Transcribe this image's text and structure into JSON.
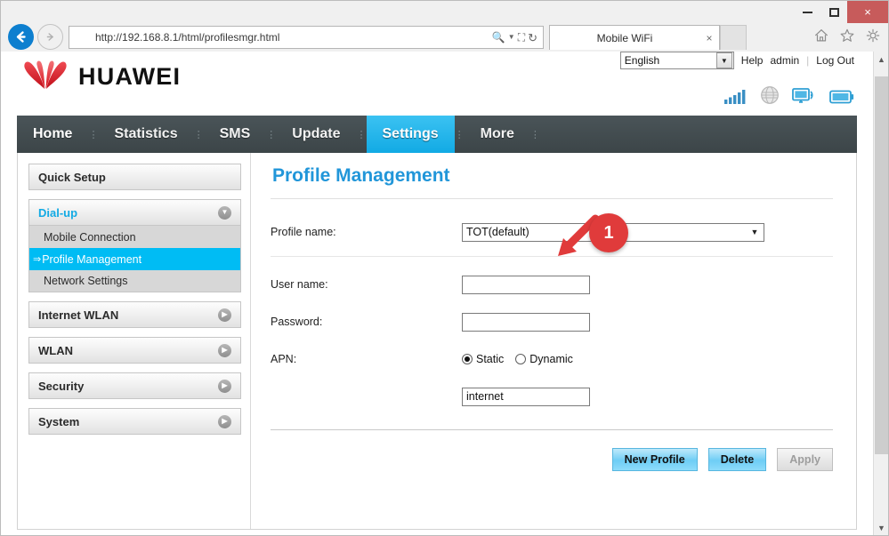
{
  "window": {
    "minimize_label": "minimize",
    "maximize_label": "maximize",
    "close_label": "×"
  },
  "browser": {
    "back_icon": "back-arrow-icon",
    "forward_icon": "forward-arrow-icon",
    "url": "http://192.168.8.1/html/profilesmgr.html",
    "search_icon": "search-icon",
    "dropdown_icon": "caret-down-icon",
    "compat_icon": "compatibility-view-icon",
    "refresh_icon": "refresh-icon",
    "tab_title": "Mobile WiFi",
    "tab_close": "×",
    "home_icon": "home-icon",
    "favorites_icon": "star-icon",
    "settings_icon": "gear-icon"
  },
  "header": {
    "brand": "HUAWEI",
    "language": "English",
    "help_label": "Help",
    "user_label": "admin",
    "separator": "|",
    "logout_label": "Log Out",
    "status_icons": [
      "signal-bars-icon",
      "globe-icon",
      "monitor-wifi-icon",
      "battery-icon"
    ]
  },
  "mainnav": {
    "items": [
      {
        "label": "Home",
        "active": false
      },
      {
        "label": "Statistics",
        "active": false
      },
      {
        "label": "SMS",
        "active": false
      },
      {
        "label": "Update",
        "active": false
      },
      {
        "label": "Settings",
        "active": true
      },
      {
        "label": "More",
        "active": false
      }
    ],
    "active_color": "#12aae4"
  },
  "sidebar": {
    "quick_setup": "Quick Setup",
    "dialup": {
      "label": "Dial-up",
      "expanded": true,
      "items": [
        {
          "label": "Mobile Connection",
          "selected": false
        },
        {
          "label": "Profile Management",
          "selected": true
        },
        {
          "label": "Network Settings",
          "selected": false
        }
      ]
    },
    "groups": [
      {
        "label": "Internet WLAN"
      },
      {
        "label": "WLAN"
      },
      {
        "label": "Security"
      },
      {
        "label": "System"
      }
    ],
    "selected_marker": "⇒",
    "selected_color": "#00bcf4"
  },
  "main": {
    "title": "Profile Management",
    "title_color": "#2196d9",
    "fields": {
      "profile_name_label": "Profile name:",
      "profile_name_value": "TOT(default)",
      "username_label": "User name:",
      "username_value": "",
      "password_label": "Password:",
      "password_value": "",
      "apn_label": "APN:",
      "apn_static_label": "Static",
      "apn_dynamic_label": "Dynamic",
      "apn_selected": "Static",
      "apn_value": "internet"
    },
    "buttons": {
      "new_profile": "New Profile",
      "delete": "Delete",
      "apply": "Apply",
      "apply_disabled": true
    }
  },
  "annotation": {
    "badge_number": "1",
    "badge_color": "#e03b3b",
    "arrow": "red-arrow-down-left"
  },
  "scrollbar": {
    "up_icon": "chevron-up-icon",
    "down_icon": "chevron-down-icon"
  }
}
